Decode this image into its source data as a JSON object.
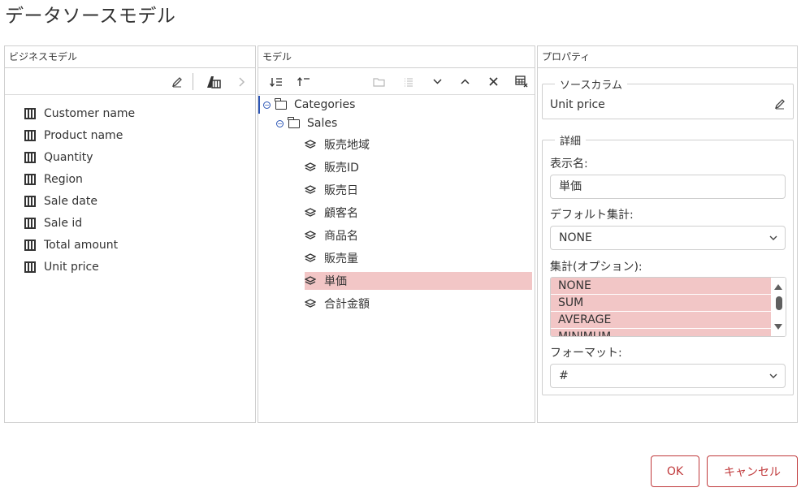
{
  "title": "データソースモデル",
  "left_panel": {
    "header": "ビジネスモデル",
    "fields": [
      "Customer name",
      "Product name",
      "Quantity",
      "Region",
      "Sale date",
      "Sale id",
      "Total amount",
      "Unit price"
    ]
  },
  "model_panel": {
    "header": "モデル",
    "tree": {
      "root": "Categories",
      "child": "Sales",
      "items": [
        "販売地域",
        "販売ID",
        "販売日",
        "顧客名",
        "商品名",
        "販売量",
        "単価",
        "合計金額"
      ],
      "selected": "単価"
    }
  },
  "properties_panel": {
    "header": "プロパティ",
    "source_column": {
      "legend": "ソースカラム",
      "value": "Unit price"
    },
    "details": {
      "legend": "詳細",
      "display_name_label": "表示名:",
      "display_name_value": "単価",
      "default_agg_label": "デフォルト集計:",
      "default_agg_value": "NONE",
      "agg_options_label": "集計(オプション):",
      "agg_options": [
        "NONE",
        "SUM",
        "AVERAGE",
        "MINIMUM"
      ],
      "format_label": "フォーマット:",
      "format_value": "#"
    }
  },
  "footer": {
    "ok_label": "OK",
    "cancel_label": "キャンセル"
  },
  "colors": {
    "accent": "#c0393b",
    "selection": "#f2c6c6",
    "tree_toggle": "#2b55b5"
  }
}
